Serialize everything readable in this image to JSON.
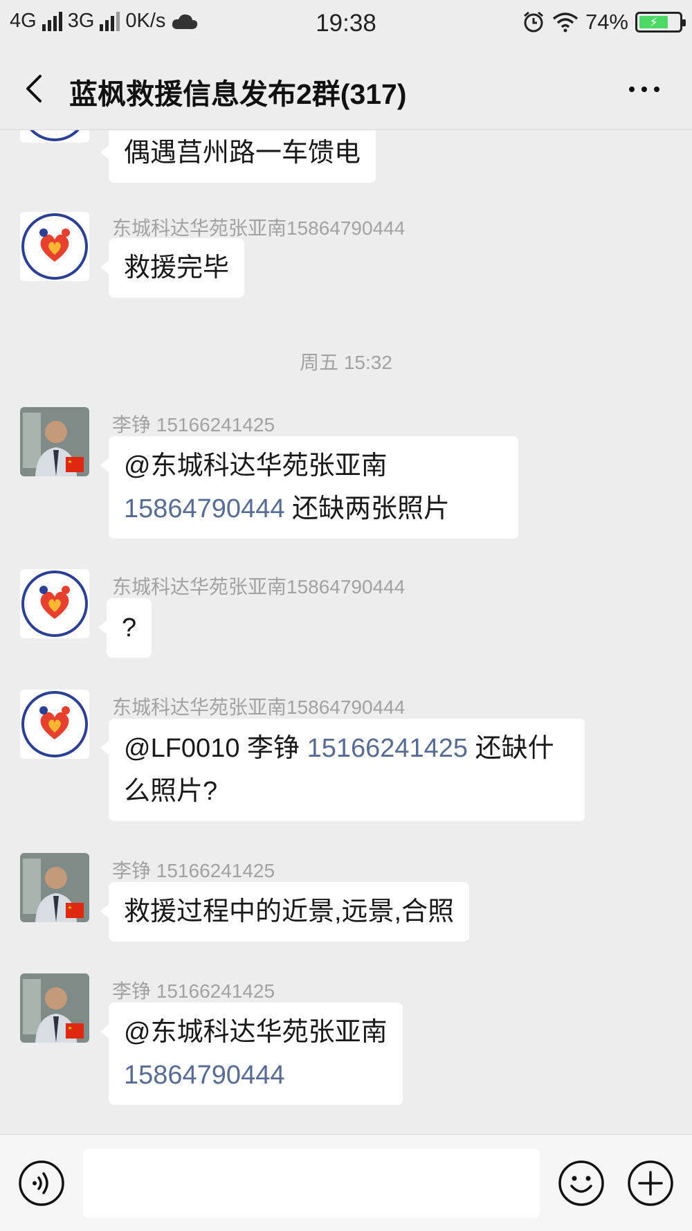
{
  "status": {
    "net1": "4G",
    "net2": "3G",
    "speed": "0K/s",
    "time": "19:38",
    "battery": "74%",
    "battery_level": 0.74
  },
  "header": {
    "title": "蓝枫救援信息发布2群(317)"
  },
  "messages": [
    {
      "text": "偶遇莒州路一车馈电"
    },
    {
      "sender": "东城科达华苑张亚南15864790444",
      "text": "救援完毕"
    },
    {
      "sender": "李铮 15166241425",
      "mention": "@东城科达华苑张亚南",
      "link": "15864790444",
      "text": " 还缺两张照片"
    },
    {
      "sender": "东城科达华苑张亚南15864790444",
      "text": "?"
    },
    {
      "sender": "东城科达华苑张亚南15864790444",
      "prefix": "@LF0010 李铮 ",
      "link": "15166241425",
      "text": " 还缺什么照片?"
    },
    {
      "sender": "李铮 15166241425",
      "text": "救援过程中的近景,远景,合照"
    },
    {
      "sender": "李铮 15166241425",
      "mention": "@东城科达华苑张亚南",
      "link": "15864790444"
    }
  ],
  "timestamp": "周五 15:32",
  "colors": {
    "background": "#ededed",
    "bubble": "#ffffff",
    "link": "#576b95",
    "meta": "#a2a2a2"
  },
  "icons": {
    "back": "chevron-left-icon",
    "more": "more-dots-icon",
    "voice": "voice-icon",
    "emoji": "emoji-icon",
    "plus": "plus-icon"
  }
}
